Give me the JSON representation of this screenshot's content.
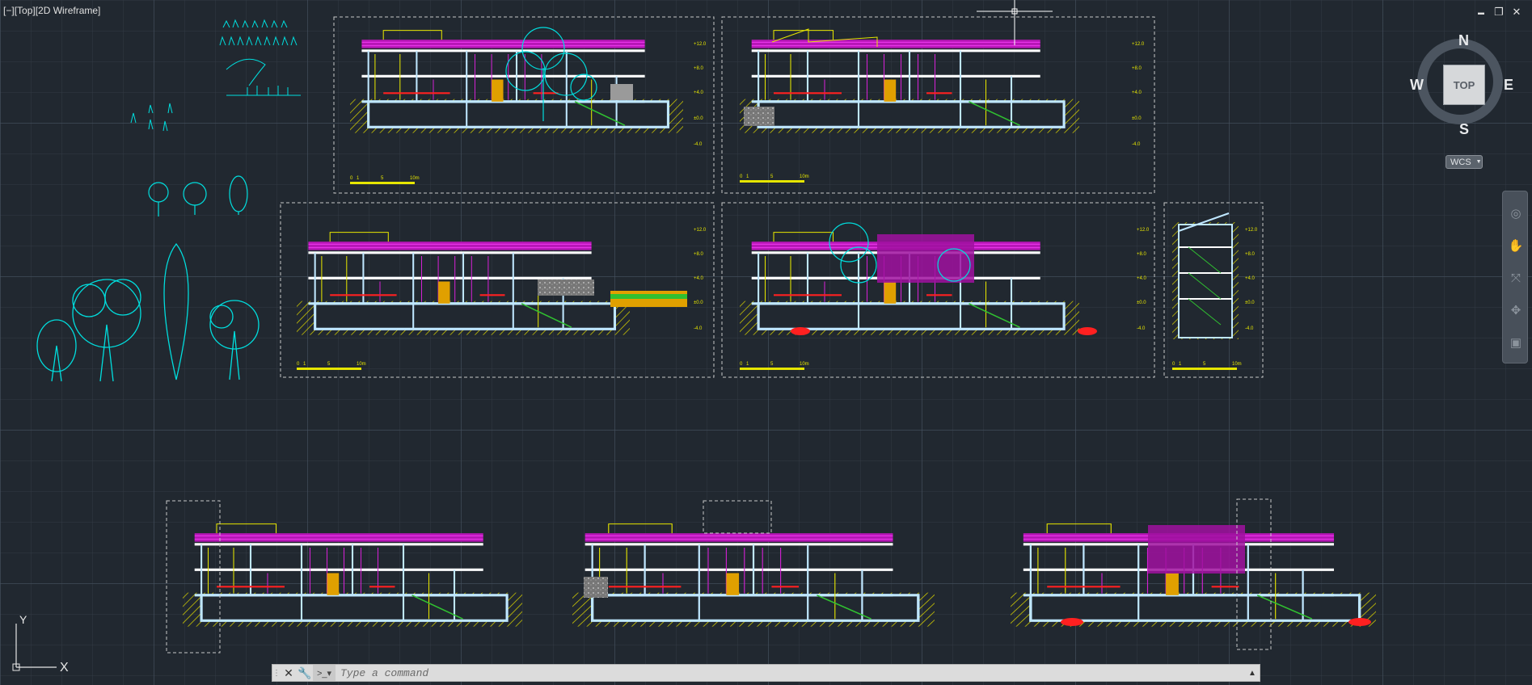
{
  "viewport": {
    "controls_label": "[−]",
    "view_label": "[Top]",
    "style_label": "[2D Wireframe]"
  },
  "window_controls": {
    "minimize": "▬",
    "restore": "❐",
    "close": "✕"
  },
  "viewcube": {
    "north": "N",
    "south": "S",
    "east": "E",
    "west": "W",
    "top": "TOP"
  },
  "wcs": {
    "label": "WCS",
    "dropdown_icon": "chevron-down-icon"
  },
  "navigation_bar": {
    "tools": [
      "steering-wheel-icon",
      "pan-icon",
      "zoom-extents-icon",
      "orbit-icon",
      "showmotion-icon"
    ]
  },
  "ucs_icon": {
    "y_label": "Y",
    "x_label": "X"
  },
  "command_line": {
    "placeholder": "Type a command",
    "value": ""
  },
  "drawing": {
    "elevation_markers": [
      "+12.0",
      "+8.0",
      "+4.0",
      "±0.0",
      "-4.0"
    ],
    "scale_bar_labels": [
      "0",
      "1",
      "5",
      "10m"
    ],
    "colors": {
      "background": "#212830",
      "white_lines": "#ffffff",
      "light_blue": "#9fd6ff",
      "magenta": "#d321d3",
      "yellow": "#e6e600",
      "orange": "#e0a000",
      "cyan": "#00e0e0",
      "red": "#ff2020",
      "green": "#30c030"
    }
  }
}
